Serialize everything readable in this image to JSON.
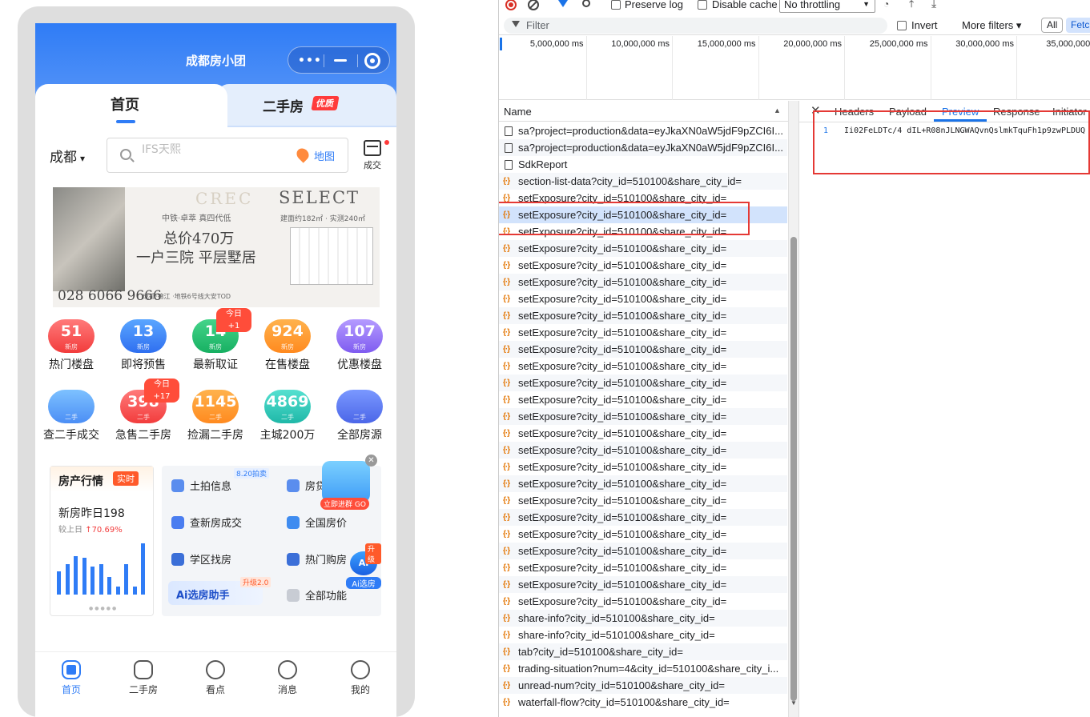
{
  "app": {
    "title": "成都房小团",
    "capsule_dots": "•••",
    "tabs": {
      "home": "首页",
      "second": "二手房",
      "second_badge": "优质"
    },
    "city": "成都",
    "search_placeholder": "IFS天熙",
    "map_label": "地图",
    "deal_label": "成交",
    "banner": {
      "brand": "CREC",
      "select": "SELECT",
      "line1": "中铁·卓萃 真四代低",
      "area": "建面约182㎡ · 实测240㎡",
      "price": "总价470万",
      "slogan": "一户三院 平层墅居",
      "phone": "028 6066 9666",
      "address": "成都·锦江 ·地铁6号线大安TOD"
    },
    "row1": [
      {
        "value": "51",
        "sub": "新房",
        "label": "热门楼盘",
        "color": "red",
        "tag": ""
      },
      {
        "value": "13",
        "sub": "新房",
        "label": "即将预售",
        "color": "blue",
        "tag": ""
      },
      {
        "value": "14",
        "sub": "新房",
        "label": "最新取证",
        "color": "green",
        "tag": "今日+1"
      },
      {
        "value": "924",
        "sub": "新房",
        "label": "在售楼盘",
        "color": "orange",
        "tag": ""
      },
      {
        "value": "107",
        "sub": "新房",
        "label": "优惠楼盘",
        "color": "purple",
        "tag": ""
      }
    ],
    "row2": [
      {
        "value": "",
        "sub": "二手",
        "label": "查二手成交",
        "color": "sky",
        "tag": ""
      },
      {
        "value": "398",
        "sub": "二手",
        "label": "急售二手房",
        "color": "red",
        "tag": "今日+17"
      },
      {
        "value": "1145",
        "sub": "二手",
        "label": "捡漏二手房",
        "color": "orange",
        "tag": ""
      },
      {
        "value": "4869",
        "sub": "二手",
        "label": "主城200万",
        "color": "cyan",
        "tag": ""
      },
      {
        "value": "",
        "sub": "二手",
        "label": "全部房源",
        "color": "indigo",
        "tag": ""
      }
    ],
    "market": {
      "title": "房产行情",
      "live": "实时",
      "value": "新房昨日198",
      "compare_prefix": "较上日",
      "compare_value": "↑70.69%",
      "bars": [
        0.45,
        0.6,
        0.75,
        0.72,
        0.55,
        0.6,
        0.35,
        0.15,
        0.6,
        0.15,
        1.0
      ]
    },
    "tools": {
      "land": "土拍信息",
      "land_tag": "8.20拍卖",
      "house_a": "房贷",
      "new_deal": "查新房成交",
      "national": "全国房价",
      "school": "学区找房",
      "hot": "热门购房",
      "ai": "Ai选房助手",
      "ai_tag": "升级2.0",
      "all": "全部功能"
    },
    "promo": {
      "cta": "立即进群 GO",
      "close": "✕"
    },
    "ai_float": {
      "head": "AI",
      "label": "Ai选房",
      "up": "升级"
    },
    "nav": [
      "首页",
      "二手房",
      "看点",
      "消息",
      "我的"
    ]
  },
  "devtools": {
    "preserve_log": "Preserve log",
    "disable_cache": "Disable cache",
    "throttling": "No throttling",
    "filter_placeholder": "Filter",
    "invert": "Invert",
    "more_filters": "More filters ▾",
    "all": "All",
    "fetch": "Fetc",
    "ticks": [
      "5,000,000 ms",
      "10,000,000 ms",
      "15,000,000 ms",
      "20,000,000 ms",
      "25,000,000 ms",
      "30,000,000 ms",
      "35,000,000 m"
    ],
    "name_col": "Name",
    "requests": [
      {
        "type": "doc",
        "name": "sa?project=production&data=eyJkaXN0aW5jdF9pZCI6I..."
      },
      {
        "type": "doc",
        "name": "sa?project=production&data=eyJkaXN0aW5jdF9pZCI6I..."
      },
      {
        "type": "doc",
        "name": "SdkReport"
      },
      {
        "type": "xhr",
        "name": "section-list-data?city_id=510100&share_city_id="
      },
      {
        "type": "xhr",
        "name": "setExposure?city_id=510100&share_city_id="
      },
      {
        "type": "xhr",
        "name": "setExposure?city_id=510100&share_city_id="
      },
      {
        "type": "xhr",
        "name": "setExposure?city_id=510100&share_city_id="
      },
      {
        "type": "xhr",
        "name": "setExposure?city_id=510100&share_city_id="
      },
      {
        "type": "xhr",
        "name": "setExposure?city_id=510100&share_city_id="
      },
      {
        "type": "xhr",
        "name": "setExposure?city_id=510100&share_city_id="
      },
      {
        "type": "xhr",
        "name": "setExposure?city_id=510100&share_city_id="
      },
      {
        "type": "xhr",
        "name": "setExposure?city_id=510100&share_city_id="
      },
      {
        "type": "xhr",
        "name": "setExposure?city_id=510100&share_city_id="
      },
      {
        "type": "xhr",
        "name": "setExposure?city_id=510100&share_city_id="
      },
      {
        "type": "xhr",
        "name": "setExposure?city_id=510100&share_city_id="
      },
      {
        "type": "xhr",
        "name": "setExposure?city_id=510100&share_city_id="
      },
      {
        "type": "xhr",
        "name": "setExposure?city_id=510100&share_city_id="
      },
      {
        "type": "xhr",
        "name": "setExposure?city_id=510100&share_city_id="
      },
      {
        "type": "xhr",
        "name": "setExposure?city_id=510100&share_city_id="
      },
      {
        "type": "xhr",
        "name": "setExposure?city_id=510100&share_city_id="
      },
      {
        "type": "xhr",
        "name": "setExposure?city_id=510100&share_city_id="
      },
      {
        "type": "xhr",
        "name": "setExposure?city_id=510100&share_city_id="
      },
      {
        "type": "xhr",
        "name": "setExposure?city_id=510100&share_city_id="
      },
      {
        "type": "xhr",
        "name": "setExposure?city_id=510100&share_city_id="
      },
      {
        "type": "xhr",
        "name": "setExposure?city_id=510100&share_city_id="
      },
      {
        "type": "xhr",
        "name": "setExposure?city_id=510100&share_city_id="
      },
      {
        "type": "xhr",
        "name": "setExposure?city_id=510100&share_city_id="
      },
      {
        "type": "xhr",
        "name": "setExposure?city_id=510100&share_city_id="
      },
      {
        "type": "xhr",
        "name": "setExposure?city_id=510100&share_city_id="
      },
      {
        "type": "xhr",
        "name": "share-info?city_id=510100&share_city_id="
      },
      {
        "type": "xhr",
        "name": "share-info?city_id=510100&share_city_id="
      },
      {
        "type": "xhr",
        "name": "tab?city_id=510100&share_city_id="
      },
      {
        "type": "xhr",
        "name": "trading-situation?num=4&city_id=510100&share_city_i..."
      },
      {
        "type": "xhr",
        "name": "unread-num?city_id=510100&share_city_id="
      },
      {
        "type": "xhr",
        "name": "waterfall-flow?city_id=510100&share_city_id="
      }
    ],
    "selected_index": 5,
    "detail_tabs": [
      "Headers",
      "Payload",
      "Preview",
      "Response",
      "Initiator"
    ],
    "active_tab": "Preview",
    "preview_line_no": "1",
    "preview_text": "Ii02FeLDTc/4 dIL+R08nJLNGWAQvnQslmkTquFh1p9zwPLDUQ"
  },
  "colors": {
    "accent": "#2f7cf6",
    "devtools_blue": "#1a73e8",
    "highlight": "#e53935"
  }
}
